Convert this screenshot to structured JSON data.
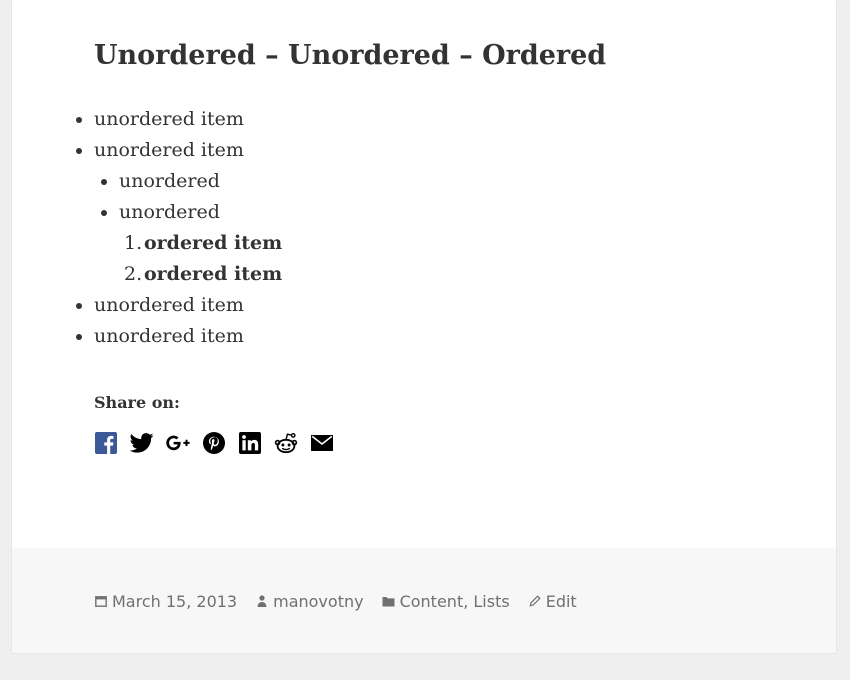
{
  "post": {
    "title": "Unordered – Unordered – Ordered",
    "list": {
      "top_items_before": [
        "unordered item",
        "unordered item"
      ],
      "nested_unordered": [
        "unordered",
        "unordered"
      ],
      "nested_ordered": [
        "ordered item",
        "ordered item"
      ],
      "top_items_after": [
        "unordered item",
        "unordered item"
      ]
    }
  },
  "share": {
    "label": "Share on:",
    "icons": [
      "facebook-icon",
      "twitter-icon",
      "google-plus-icon",
      "pinterest-icon",
      "linkedin-icon",
      "reddit-icon",
      "email-icon"
    ],
    "facebook_color": "#3b5998"
  },
  "footer": {
    "date": "March 15, 2013",
    "author": "manovotny",
    "categories": [
      "Content",
      "Lists"
    ],
    "category_separator": ", ",
    "edit_label": "Edit"
  },
  "colors": {
    "page_background": "#efefef",
    "card_background": "#ffffff",
    "footer_background": "#f7f7f7",
    "text": "#333333",
    "meta_text": "#707070"
  }
}
